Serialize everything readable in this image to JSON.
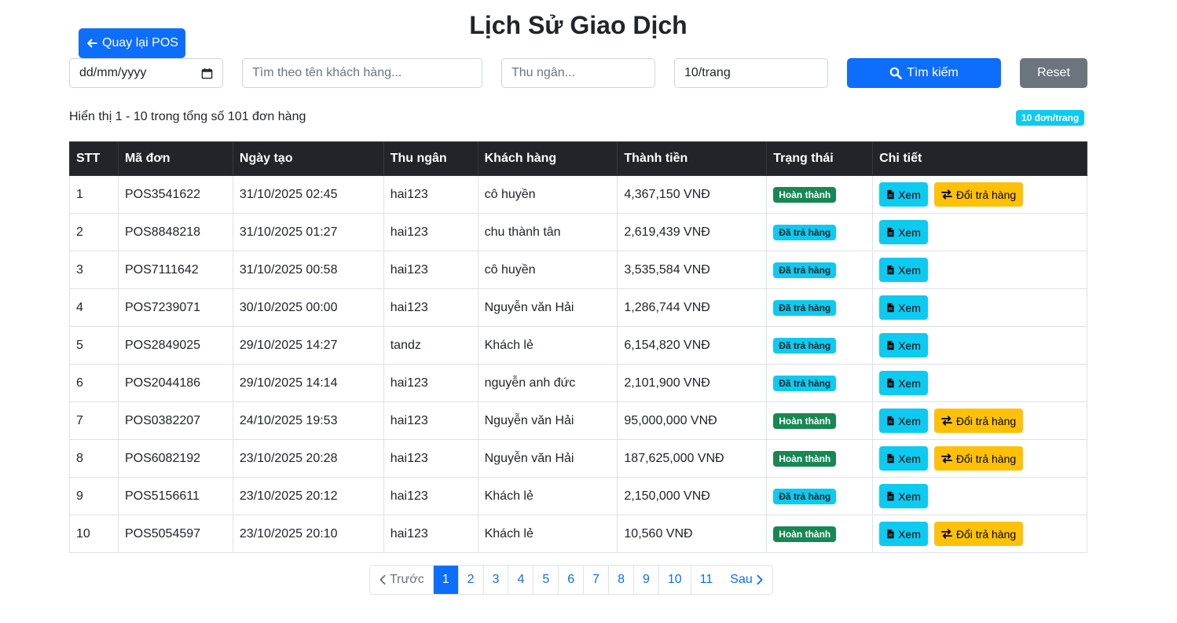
{
  "page_title": "Lịch Sử Giao Dịch",
  "back_button": "Quay lại POS",
  "filters": {
    "date_placeholder": "dd/mm/yyyy",
    "customer_placeholder": "Tìm theo tên khách hàng...",
    "cashier_placeholder": "Thu ngân...",
    "per_page_value": "10/trang",
    "search_label": "Tìm kiếm",
    "reset_label": "Reset"
  },
  "summary": "Hiển thị 1 - 10 trong tổng số 101 đơn hàng",
  "per_page_badge": "10 đơn/trang",
  "table": {
    "headers": [
      "STT",
      "Mã đơn",
      "Ngày tạo",
      "Thu ngân",
      "Khách hàng",
      "Thành tiền",
      "Trạng thái",
      "Chi tiết"
    ],
    "view_label": "Xem",
    "exchange_label": "Đổi trả hàng",
    "rows": [
      {
        "stt": "1",
        "code": "POS3541622",
        "date": "31/10/2025 02:45",
        "cashier": "hai123",
        "customer": "cô huyền",
        "total": "4,367,150 VNĐ",
        "status": "Hoàn thành"
      },
      {
        "stt": "2",
        "code": "POS8848218",
        "date": "31/10/2025 01:27",
        "cashier": "hai123",
        "customer": "chu thành tân",
        "total": "2,619,439 VNĐ",
        "status": "Đã trả hàng"
      },
      {
        "stt": "3",
        "code": "POS7111642",
        "date": "31/10/2025 00:58",
        "cashier": "hai123",
        "customer": "cô huyền",
        "total": "3,535,584 VNĐ",
        "status": "Đã trả hàng"
      },
      {
        "stt": "4",
        "code": "POS7239071",
        "date": "30/10/2025 00:00",
        "cashier": "hai123",
        "customer": "Nguyễn văn Hải",
        "total": "1,286,744 VNĐ",
        "status": "Đã trả hàng"
      },
      {
        "stt": "5",
        "code": "POS2849025",
        "date": "29/10/2025 14:27",
        "cashier": "tandz",
        "customer": "Khách lẻ",
        "total": "6,154,820 VNĐ",
        "status": "Đã trả hàng"
      },
      {
        "stt": "6",
        "code": "POS2044186",
        "date": "29/10/2025 14:14",
        "cashier": "hai123",
        "customer": "nguyễn anh đức",
        "total": "2,101,900 VNĐ",
        "status": "Đã trả hàng"
      },
      {
        "stt": "7",
        "code": "POS0382207",
        "date": "24/10/2025 19:53",
        "cashier": "hai123",
        "customer": "Nguyễn văn Hải",
        "total": "95,000,000 VNĐ",
        "status": "Hoàn thành"
      },
      {
        "stt": "8",
        "code": "POS6082192",
        "date": "23/10/2025 20:28",
        "cashier": "hai123",
        "customer": "Nguyễn văn Hải",
        "total": "187,625,000 VNĐ",
        "status": "Hoàn thành"
      },
      {
        "stt": "9",
        "code": "POS5156611",
        "date": "23/10/2025 20:12",
        "cashier": "hai123",
        "customer": "Khách lẻ",
        "total": "2,150,000 VNĐ",
        "status": "Đã trả hàng"
      },
      {
        "stt": "10",
        "code": "POS5054597",
        "date": "23/10/2025 20:10",
        "cashier": "hai123",
        "customer": "Khách lẻ",
        "total": "10,560 VNĐ",
        "status": "Hoàn thành"
      }
    ]
  },
  "pagination": {
    "prev_label": "Trước",
    "next_label": "Sau",
    "pages": [
      "1",
      "2",
      "3",
      "4",
      "5",
      "6",
      "7",
      "8",
      "9",
      "10",
      "11"
    ],
    "active_page": "1"
  },
  "colors": {
    "primary": "#0d6efd",
    "success": "#198754",
    "info": "#0dcaf0",
    "warning": "#ffc107",
    "dark": "#212529"
  }
}
